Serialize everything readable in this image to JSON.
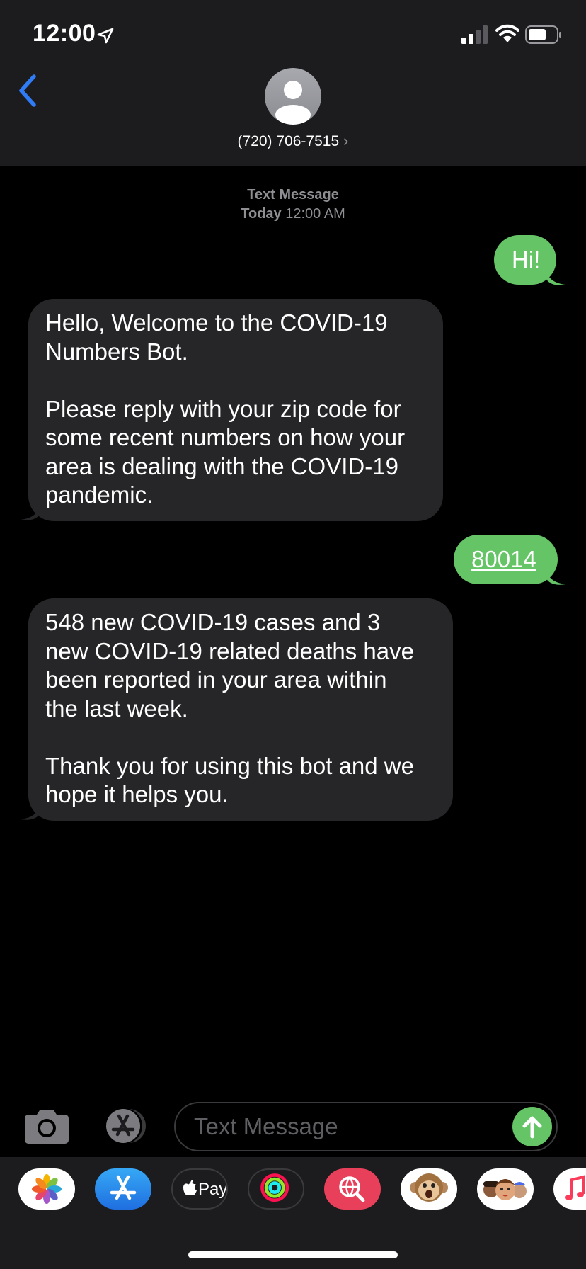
{
  "status_bar": {
    "time": "12:00"
  },
  "header": {
    "contact": "(720) 706-7515",
    "chevron": "›"
  },
  "timestamp": {
    "service": "Text Message",
    "day": "Today",
    "time": "12:00 AM"
  },
  "messages": [
    {
      "direction": "sent",
      "text": "Hi!"
    },
    {
      "direction": "received",
      "text": "Hello, Welcome to the COVID-19\nNumbers Bot.\n\nPlease reply with your zip code for\nsome recent numbers on how your\narea is dealing with the COVID-19\npandemic."
    },
    {
      "direction": "sent",
      "text": "80014"
    },
    {
      "direction": "received",
      "text": "548 new COVID-19 cases and 3\nnew COVID-19 related deaths have\nbeen reported in your area within\nthe last week.\n\nThank you for using this bot and we\nhope it helps you."
    }
  ],
  "composer": {
    "placeholder": "Text Message"
  },
  "drawer": {
    "apple_pay_label": "Pay",
    "apps": [
      "photos-app-icon",
      "app-store-app-icon",
      "apple-pay-app-icon",
      "activity-app-icon",
      "web-images-app-icon",
      "monkey-animoji-app-icon",
      "memoji-app-icon",
      "music-app-icon"
    ]
  },
  "colors": {
    "sent_bubble": "#65c466",
    "received_bubble": "#262628",
    "accent_blue": "#2f7cf6",
    "background": "#000000"
  }
}
